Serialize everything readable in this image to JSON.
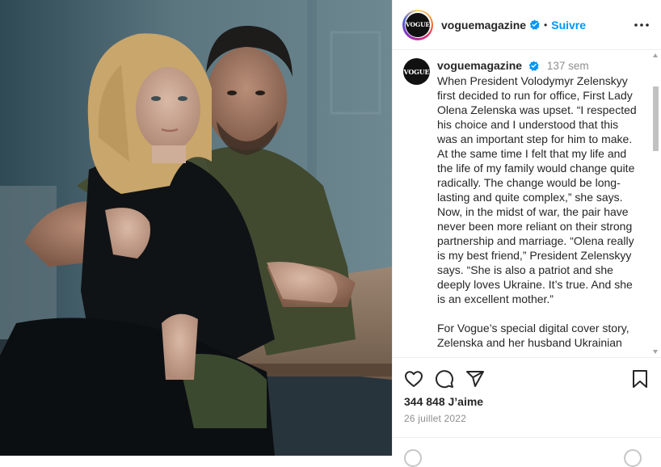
{
  "post": {
    "username": "voguemagazine",
    "avatar_text": "VOGUE",
    "follow_label": "Suivre",
    "separator": "•",
    "more_icon": "more-horizontal-icon",
    "verified_icon": "verified-badge-icon"
  },
  "caption": {
    "username": "voguemagazine",
    "time": "137 sem",
    "text": "When President Volodymyr Zelenskyy first decided to run for office, First Lady Olena Zelenska was upset. “I respected his choice and I understood that this was an important step for him to make. At the same time I felt that my life and the life of my family would change quite radically. The change would be long-lasting and quite complex,” she says. Now, in the midst of war, the pair have never been more reliant on their strong partnership and marriage. “Olena really is my best friend,” President Zelenskyy says. “She is also a patriot and she deeply loves Ukraine. It’s true. And she is an excellent mother.”\n\nFor Vogue’s special digital cover story, Zelenska and her husband Ukrainian"
  },
  "actions": {
    "like_icon": "heart-icon",
    "comment_icon": "comment-icon",
    "share_icon": "send-icon",
    "save_icon": "bookmark-icon"
  },
  "likes_label": "344 848 J’aime",
  "date_label": "26 juillet 2022",
  "colors": {
    "accent": "#0095f6",
    "text": "#262626",
    "muted": "#8e8e8e",
    "border": "#efefef"
  }
}
